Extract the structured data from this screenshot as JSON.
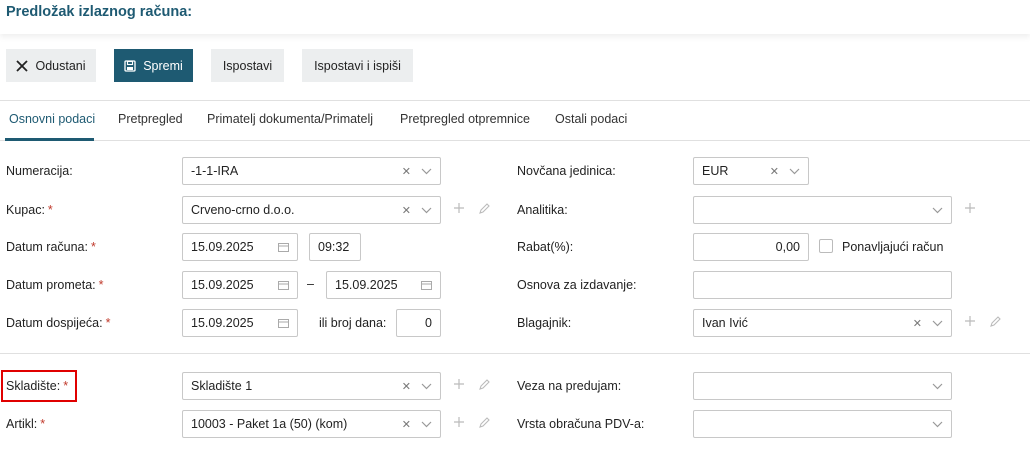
{
  "header": {
    "title": "Predložak izlaznog računa:"
  },
  "toolbar": {
    "cancel": "Odustani",
    "save": "Spremi",
    "fill": "Ispostavi",
    "fill_print": "Ispostavi i ispiši"
  },
  "tabs": [
    {
      "label": "Osnovni podaci",
      "active": true
    },
    {
      "label": "Pretpregled"
    },
    {
      "label": "Primatelj dokumenta/Primatelj"
    },
    {
      "label": "Pretpregled otpremnice"
    },
    {
      "label": "Ostali podaci"
    }
  ],
  "form": {
    "numeracija": {
      "label": "Numeracija:",
      "value": "-1-1-IRA"
    },
    "kupac": {
      "label": "Kupac:",
      "required": "*",
      "value": "Crveno-crno d.o.o."
    },
    "datum_racuna": {
      "label": "Datum računa:",
      "required": "*",
      "date": "15.09.2025",
      "time": "09:32"
    },
    "datum_prometa": {
      "label": "Datum prometa:",
      "required": "*",
      "from": "15.09.2025",
      "separator": "–",
      "to": "15.09.2025"
    },
    "datum_dospijeca": {
      "label": "Datum dospijeća:",
      "required": "*",
      "date": "15.09.2025",
      "days_label": "ili broj dana:",
      "days": "0"
    },
    "novcana_jedinica": {
      "label": "Novčana jedinica:",
      "value": "EUR"
    },
    "analitika": {
      "label": "Analitika:",
      "value": ""
    },
    "rabat": {
      "label": "Rabat(%):",
      "value": "0,00",
      "recurring_label": "Ponavljajući račun"
    },
    "osnova": {
      "label": "Osnova za izdavanje:",
      "value": ""
    },
    "blagajnik": {
      "label": "Blagajnik:",
      "value": "Ivan Ivić"
    },
    "skladiste": {
      "label": "Skladište:",
      "required": "*",
      "value": "Skladište 1"
    },
    "artikl": {
      "label": "Artikl:",
      "required": "*",
      "value": "10003 - Paket 1a (50) (kom)"
    },
    "veza": {
      "label": "Veza na predujam:",
      "value": ""
    },
    "vrsta_pdv": {
      "label": "Vrsta obračuna PDV-a:",
      "value": ""
    }
  },
  "icons": {
    "clear": "✕"
  },
  "colors": {
    "primary": "#1e5a72",
    "required": "#c0392b",
    "highlight": "#e00000"
  }
}
